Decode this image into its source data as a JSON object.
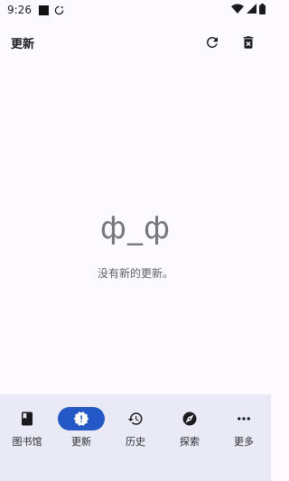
{
  "status_bar": {
    "time": "9:26"
  },
  "app_bar": {
    "title": "更新"
  },
  "empty_state": {
    "face": "ф_ф",
    "message": "没有新的更新。"
  },
  "bottom_nav": {
    "items": [
      {
        "label": "图书馆",
        "icon": "book-icon"
      },
      {
        "label": "更新",
        "icon": "new-releases-icon",
        "active": true
      },
      {
        "label": "历史",
        "icon": "history-icon"
      },
      {
        "label": "探索",
        "icon": "compass-icon"
      },
      {
        "label": "更多",
        "icon": "more-horiz-icon"
      }
    ]
  },
  "colors": {
    "nav_active": "#2458c6",
    "nav_background": "#eaeaf6",
    "background": "#fcfaff"
  }
}
